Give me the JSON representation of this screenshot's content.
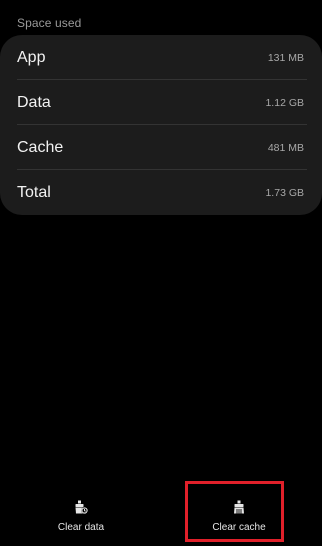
{
  "section": {
    "title": "Space used"
  },
  "storage_rows": [
    {
      "label": "App",
      "value": "131 MB"
    },
    {
      "label": "Data",
      "value": "1.12 GB"
    },
    {
      "label": "Cache",
      "value": "481 MB"
    },
    {
      "label": "Total",
      "value": "1.73 GB"
    }
  ],
  "actions": {
    "clear_data": {
      "label": "Clear data",
      "icon": "clear-data-icon"
    },
    "clear_cache": {
      "label": "Clear cache",
      "icon": "broom-icon"
    }
  },
  "colors": {
    "background": "#000000",
    "card": "#1c1c1c",
    "highlight": "#e0202a"
  }
}
